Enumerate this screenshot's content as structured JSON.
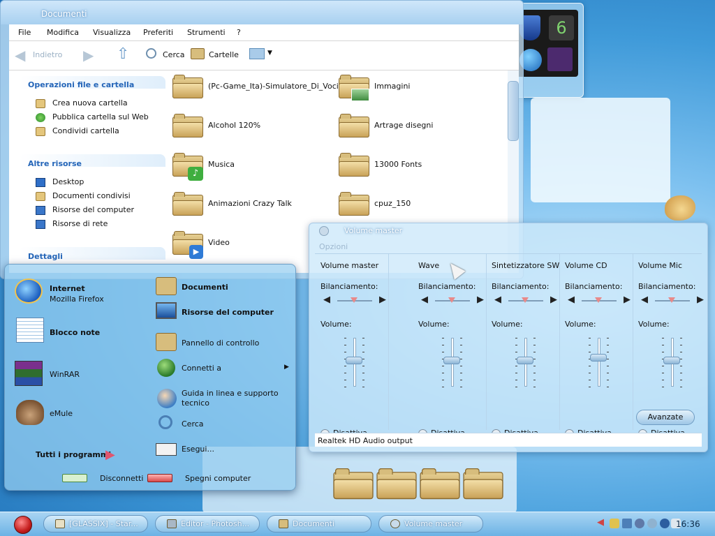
{
  "explorer": {
    "title": "Documenti",
    "menu": [
      "File",
      "Modifica",
      "Visualizza",
      "Preferiti",
      "Strumenti",
      "?"
    ],
    "toolbar": {
      "back": "Indietro",
      "search": "Cerca",
      "folders": "Cartelle"
    },
    "tasks": {
      "file_ops_title": "Operazioni file e cartella",
      "file_ops": [
        "Crea nuova cartella",
        "Pubblica cartella sul Web",
        "Condividi cartella"
      ],
      "other_title": "Altre risorse",
      "other": [
        "Desktop",
        "Documenti condivisi",
        "Risorse del computer",
        "Risorse di rete"
      ],
      "details_title": "Dettagli"
    },
    "files": [
      "(Pc-Game_Ita)-Simulatore_Di_Voci",
      "Immagini",
      "Alcohol 120%",
      "Artrage disegni",
      "Musica",
      "13000 Fonts",
      "Animazioni Crazy Talk",
      "cpuz_150",
      "Video"
    ]
  },
  "mixer": {
    "title": "Volume master",
    "menu_label": "Opzioni",
    "balance_label": "Bilanciamento:",
    "volume_label": "Volume:",
    "mute_label": "Disattiva",
    "advanced_label": "Avanzate",
    "status": "Realtek HD Audio output",
    "channels": [
      {
        "name": "Volume master",
        "volume": 0.55
      },
      {
        "name": "Wave",
        "volume": 0.55
      },
      {
        "name": "Sintetizzatore SW",
        "volume": 0.55
      },
      {
        "name": "Volume CD",
        "volume": 0.6
      },
      {
        "name": "Volume Mic",
        "volume": 0.55
      }
    ]
  },
  "start_menu": {
    "pinned": [
      {
        "title": "Internet",
        "subtitle": "Mozilla Firefox"
      },
      {
        "title": "Blocco note",
        "subtitle": ""
      },
      {
        "title": "WinRAR",
        "subtitle": ""
      },
      {
        "title": "eMule",
        "subtitle": ""
      }
    ],
    "all_programs": "Tutti i programmi",
    "right": [
      {
        "label": "Documenti",
        "bold": true
      },
      {
        "label": "Risorse del computer",
        "bold": true
      },
      {
        "label": "Pannello di controllo",
        "bold": false
      },
      {
        "label": "Connetti a",
        "bold": false
      },
      {
        "label": "Guida in linea e supporto tecnico",
        "bold": false
      },
      {
        "label": "Cerca",
        "bold": false
      },
      {
        "label": "Esegui...",
        "bold": false
      }
    ],
    "logoff": "Disconnetti",
    "shutdown": "Spegni computer"
  },
  "taskbar": {
    "buttons": [
      "[GLASSIX] - Star...",
      "Editor - Photosh...",
      "Documenti",
      "Volume master"
    ],
    "clock": "16:36"
  },
  "colors": {
    "link_blue": "#2465b8",
    "orb_red": "#c41d1d",
    "folder_tan": "#d7bd7d"
  }
}
